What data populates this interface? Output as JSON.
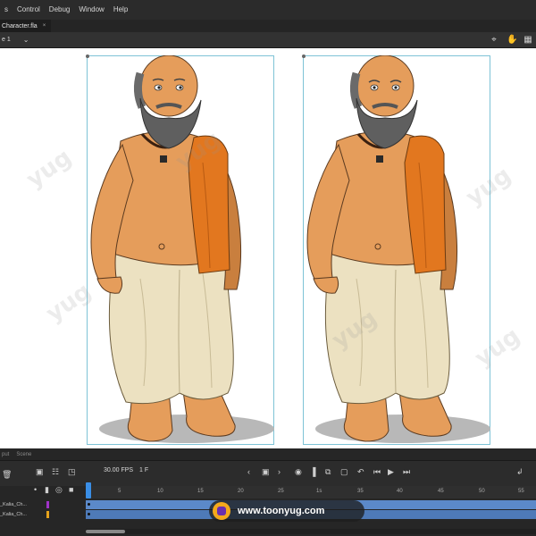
{
  "menu": [
    "s",
    "Control",
    "Debug",
    "Window",
    "Help"
  ],
  "tab": {
    "title": "Character.fla",
    "close": "×"
  },
  "editbar": {
    "scene": "e 1",
    "dropdown": "⌄"
  },
  "watermark": "yug",
  "timeline": {
    "tabs": [
      "put",
      "Scene"
    ],
    "fps": "30.00 FPS",
    "frame": "1 F",
    "ruler": [
      "5",
      "10",
      "15",
      "20",
      "25",
      "1s",
      "35",
      "40",
      "45",
      "50",
      "55"
    ],
    "layers": [
      {
        "name": "_Kalia_Ch...",
        "color": "#a033c8"
      },
      {
        "name": "_Kalia_Ch...",
        "color": "#e5a21c"
      }
    ]
  },
  "banner": {
    "text": "www.toonyug.com"
  },
  "colors": {
    "skin": "#e59d5b",
    "skin_shadow": "#c97f3e",
    "dhoti": "#ece1c1",
    "shawl": "#e2771f",
    "beard": "#5f5f5f",
    "frame_outline": "#7ec3d6"
  }
}
